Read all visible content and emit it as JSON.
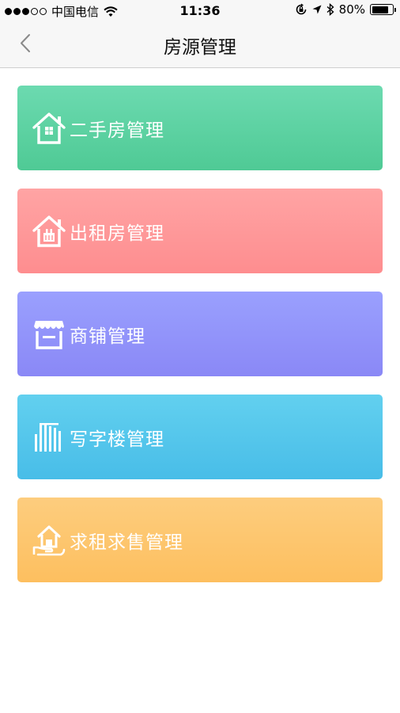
{
  "status_bar": {
    "carrier": "中国电信",
    "time": "11:36",
    "battery_percent": "80%",
    "battery_level": 0.8
  },
  "nav": {
    "title": "房源管理"
  },
  "cards": [
    {
      "label": "二手房管理",
      "icon": "house-icon",
      "color_top": "#6cdab0",
      "color_bottom": "#4fca95"
    },
    {
      "label": "出租房管理",
      "icon": "house-rent-icon",
      "color_top": "#ffa4a4",
      "color_bottom": "#fe8d8f"
    },
    {
      "label": "商铺管理",
      "icon": "shop-icon",
      "color_top": "#9aa0fe",
      "color_bottom": "#8a88f6"
    },
    {
      "label": "写字楼管理",
      "icon": "office-building-icon",
      "color_top": "#62d0ef",
      "color_bottom": "#48bde8"
    },
    {
      "label": "求租求售管理",
      "icon": "house-hand-icon",
      "color_top": "#fdcd7e",
      "color_bottom": "#fdbf5f"
    }
  ]
}
